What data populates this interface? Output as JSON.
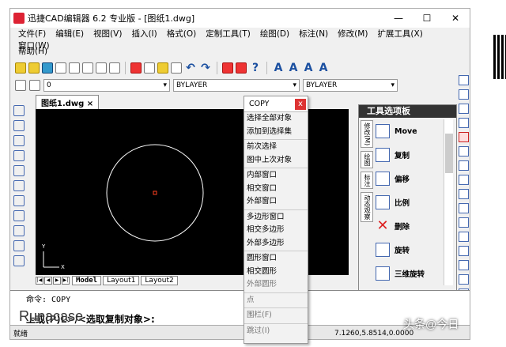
{
  "window": {
    "title": "迅捷CAD编辑器 6.2 专业版 - [图纸1.dwg]",
    "minimize": "—",
    "maximize": "☐",
    "close": "✕"
  },
  "menubar": [
    "文件(F)",
    "编辑(E)",
    "视图(V)",
    "插入(I)",
    "格式(O)",
    "定制工具(T)",
    "绘图(D)",
    "标注(N)",
    "修改(M)",
    "扩展工具(X)",
    "窗口(W)"
  ],
  "help": "帮助(H)",
  "layer": {
    "value": "0",
    "linetype": "BYLAYER",
    "lineweight": "BYLAYER"
  },
  "tabs": {
    "doc": "图纸1.dwg",
    "close": "×"
  },
  "layouts": [
    "Model",
    "Layout1",
    "Layout2"
  ],
  "command": {
    "line1": "命令:  COPY",
    "line2": "上或(P)L>/<选取复制对象>:"
  },
  "status": {
    "left": "就绪",
    "coords": "7.1260,5.8514,0.0000"
  },
  "watermarks": {
    "brand": "Runacase",
    "source": "头条@今日"
  },
  "context_menu": {
    "title": "COPY",
    "close": "x",
    "groups": [
      [
        "选择全部对象",
        "添加到选择集"
      ],
      [
        "前次选择",
        "图中上次对象"
      ],
      [
        "内部窗口",
        "相交窗口",
        "外部窗口"
      ],
      [
        "多边形窗口",
        "相交多边形",
        "外部多边形"
      ],
      [
        "圆形窗口",
        "相交圆形",
        "外部圆形"
      ],
      [
        "点"
      ],
      [
        "围栏(F)"
      ],
      [
        "跳过(I)"
      ]
    ]
  },
  "palette": {
    "title": "工具选项板",
    "sidetabs": [
      "修改(M)",
      "绘图",
      "标注",
      "动态观察"
    ],
    "tools": [
      "Move",
      "复制",
      "偏移",
      "比例",
      "删除",
      "旋转",
      "三维旋转"
    ]
  },
  "colors": {
    "canvas": "#000000",
    "circle": "#ffffff",
    "center": "#ff4020"
  }
}
